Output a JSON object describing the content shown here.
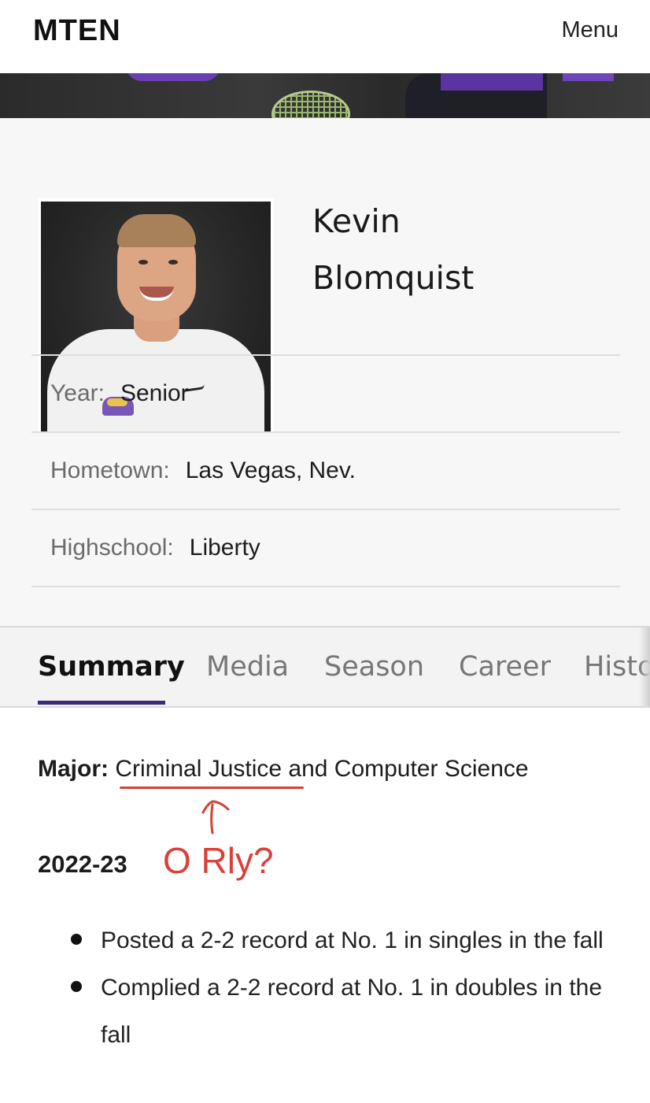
{
  "header": {
    "logo": "MTEN",
    "menu_label": "Menu"
  },
  "player": {
    "first_name": "Kevin",
    "last_name": "Blomquist"
  },
  "info": [
    {
      "label": "Year:",
      "value": "Senior"
    },
    {
      "label": "Hometown:",
      "value": "Las Vegas, Nev."
    },
    {
      "label": "Highschool:",
      "value": "Liberty"
    }
  ],
  "tabs": [
    {
      "label": "Summary",
      "active": true
    },
    {
      "label": "Media",
      "active": false
    },
    {
      "label": "Season",
      "active": false
    },
    {
      "label": "Career",
      "active": false
    },
    {
      "label": "Histo",
      "active": false
    }
  ],
  "summary": {
    "major_label": "Major:",
    "major_value": "Criminal Justice and Computer Science",
    "annotation": "O Rly?",
    "season_year": "2022-23",
    "bullets": [
      "Posted a 2-2 record at No. 1 in singles in the fall",
      "Complied a 2-2 record at No. 1 in doubles in the fall"
    ]
  },
  "colors": {
    "accent": "#3c2a78",
    "annotation": "#d94238",
    "panel_bg": "#f7f7f7"
  }
}
